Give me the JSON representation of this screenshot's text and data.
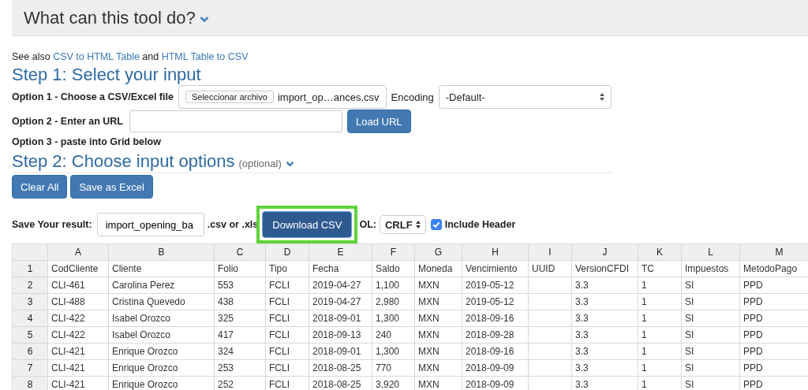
{
  "header": {
    "title": "What can this tool do?"
  },
  "see_also": {
    "prefix": "See also",
    "links": [
      "CSV to HTML Table",
      "HTML Table to CSV"
    ],
    "joiner": "and"
  },
  "step1": {
    "title": "Step 1: Select your input",
    "options": [
      {
        "kind": "file",
        "label": "Option 1 - Choose a CSV/Excel file",
        "button": "Seleccionar archivo",
        "file_name": "import_op…ances.csv",
        "encoding_label": "Encoding",
        "encoding_value": "-Default-"
      },
      {
        "kind": "url",
        "label": "Option 2 - Enter an URL",
        "button": "Load URL"
      },
      {
        "kind": "text",
        "label": "Option 3 - paste into Grid below"
      }
    ]
  },
  "step2": {
    "title": "Step 2: Choose input options",
    "note": "(optional)",
    "buttons": [
      "Clear All",
      "Save as Excel"
    ]
  },
  "save": {
    "label": "Save Your result:",
    "filename_value": "import_opening_ba",
    "extension_text": ".csv or .xls",
    "download_button": "Download CSV",
    "highlighted": true,
    "eol_label": "OL:",
    "eol_value": "CRLF",
    "include_header": {
      "label": "Include Header",
      "checked": true
    }
  },
  "grid": {
    "columns": [
      "A",
      "B",
      "C",
      "D",
      "E",
      "F",
      "G",
      "H",
      "I",
      "J",
      "K",
      "L",
      "M"
    ],
    "rows": [
      {
        "number": "1",
        "cells": [
          "CodCliente",
          "Cliente",
          "Folio",
          "Tipo",
          "Fecha",
          "Saldo",
          "Moneda",
          "Vencimiento",
          "UUID",
          "VersionCFDI",
          "TC",
          "Impuestos",
          "MetodoPago"
        ]
      },
      {
        "number": "2",
        "cells": [
          "CLI-461",
          "Carolina Perez",
          "553",
          "FCLI",
          "2019-04-27",
          "1,100",
          "MXN",
          "2019-05-12",
          "",
          "3.3",
          "1",
          "SI",
          "PPD"
        ]
      },
      {
        "number": "3",
        "cells": [
          "CLI-488",
          "Cristina Quevedo",
          "438",
          "FCLI",
          "2019-04-27",
          "2,980",
          "MXN",
          "2019-05-12",
          "",
          "3.3",
          "1",
          "SI",
          "PPD"
        ]
      },
      {
        "number": "4",
        "cells": [
          "CLI-422",
          "Isabel Orozco",
          "325",
          "FCLI",
          "2018-09-01",
          "1,300",
          "MXN",
          "2018-09-16",
          "",
          "3.3",
          "1",
          "SI",
          "PPD"
        ]
      },
      {
        "number": "5",
        "cells": [
          "CLI-422",
          "Isabel Orozco",
          "417",
          "FCLI",
          "2018-09-13",
          "240",
          "MXN",
          "2018-09-28",
          "",
          "3.3",
          "1",
          "SI",
          "PPD"
        ]
      },
      {
        "number": "6",
        "cells": [
          "CLI-421",
          "Enrique Orozco",
          "324",
          "FCLI",
          "2018-09-01",
          "1,300",
          "MXN",
          "2018-09-16",
          "",
          "3.3",
          "1",
          "SI",
          "PPD"
        ]
      },
      {
        "number": "7",
        "cells": [
          "CLI-421",
          "Enrique Orozco",
          "253",
          "FCLI",
          "2018-08-25",
          "770",
          "MXN",
          "2018-09-09",
          "",
          "3.3",
          "1",
          "SI",
          "PPD"
        ]
      },
      {
        "number": "8",
        "cells": [
          "CLI-421",
          "Enrique Orozco",
          "252",
          "FCLI",
          "2018-08-25",
          "3,920",
          "MXN",
          "2018-09-09",
          "",
          "3.3",
          "1",
          "SI",
          "PPD"
        ]
      }
    ]
  }
}
